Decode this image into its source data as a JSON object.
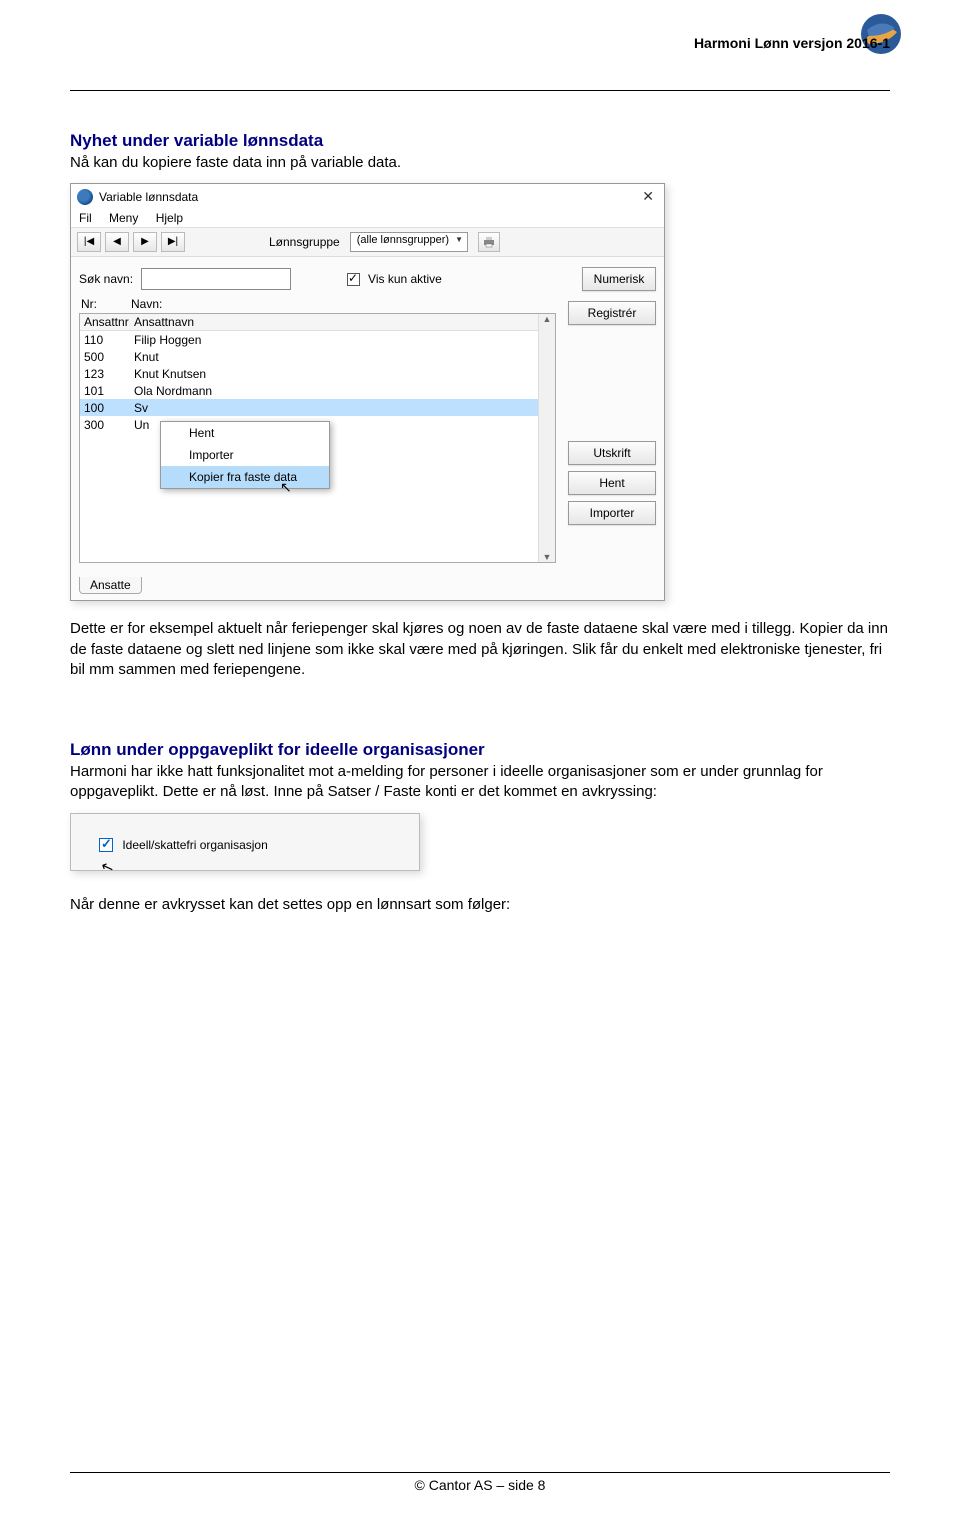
{
  "header": {
    "doc_title": "Harmoni Lønn versjon 2016-1"
  },
  "section1": {
    "heading": "Nyhet under variable lønnsdata",
    "intro": "Nå kan du kopiere faste data inn på variable data."
  },
  "screenshot1": {
    "window_title": "Variable lønnsdata",
    "menu": {
      "fil": "Fil",
      "meny": "Meny",
      "hjelp": "Hjelp"
    },
    "toolbar": {
      "lonnsgruppe_label": "Lønnsgruppe",
      "lonnsgruppe_value": "(alle lønnsgrupper)"
    },
    "search": {
      "label": "Søk navn:",
      "vis_kun_aktive": "Vis kun aktive",
      "numerisk": "Numerisk"
    },
    "list": {
      "col_nr": "Nr:",
      "col_navn": "Navn:",
      "header_ansattnr": "Ansattnr",
      "header_ansattnavn": "Ansattnavn",
      "rows": [
        {
          "nr": "110",
          "navn": "Filip Hoggen"
        },
        {
          "nr": "500",
          "navn": "Knut"
        },
        {
          "nr": "123",
          "navn": "Knut Knutsen"
        },
        {
          "nr": "101",
          "navn": "Ola Nordmann"
        },
        {
          "nr": "100",
          "navn": "Sv"
        },
        {
          "nr": "300",
          "navn": "Un"
        }
      ]
    },
    "context_menu": {
      "hent": "Hent",
      "importer": "Importer",
      "kopier": "Kopier fra faste data"
    },
    "buttons": {
      "registrer": "Registrér",
      "utskrift": "Utskrift",
      "hent": "Hent",
      "importer": "Importer"
    },
    "tab": "Ansatte"
  },
  "para1": "Dette er for eksempel aktuelt når feriepenger skal kjøres og noen av de faste dataene skal være med i tillegg. Kopier da inn de faste dataene og slett ned linjene som ikke skal være med på kjøringen. Slik får du enkelt med elektroniske tjenester, fri bil mm sammen med feriepengene.",
  "section2": {
    "heading": "Lønn under oppgaveplikt for ideelle organisasjoner",
    "para": "Harmoni har ikke hatt funksjonalitet mot a-melding for personer i ideelle organisasjoner som er under grunnlag for oppgaveplikt. Dette er nå løst. Inne på Satser / Faste konti er det kommet en avkryssing:"
  },
  "screenshot2": {
    "label": "Ideell/skattefri organisasjon"
  },
  "para3": "Når denne er avkrysset kan det settes opp en lønnsart som følger:",
  "footer": "© Cantor AS – side 8"
}
